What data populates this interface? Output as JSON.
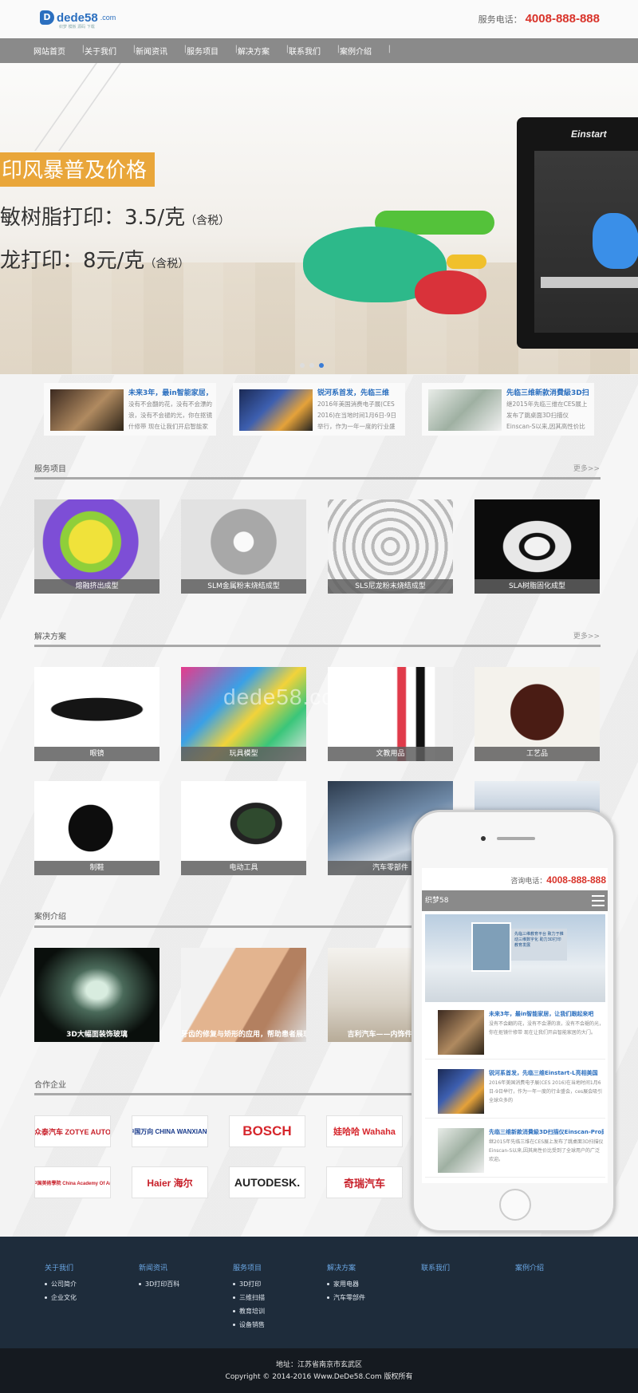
{
  "header": {
    "logo_text": "dede58",
    "logo_domain": ".com",
    "logo_sub": "织梦 模板 源码 下载",
    "hotline_label": "服务电话：",
    "hotline_number": "4008-888-888"
  },
  "nav": {
    "items": [
      {
        "label": "网站首页"
      },
      {
        "label": "关于我们"
      },
      {
        "label": "新闻资讯"
      },
      {
        "label": "服务项目"
      },
      {
        "label": "解决方案"
      },
      {
        "label": "联系我们"
      },
      {
        "label": "案例介绍"
      }
    ]
  },
  "banner": {
    "tag": "印风暴普及价格",
    "line1": "敏树脂打印：3.5/克",
    "line1_small": "（含税）",
    "line2": "龙打印：8元/克",
    "line2_small": "（含税）",
    "printer_brand": "Einstart",
    "active_slide": 3,
    "slide_count": 3
  },
  "news": [
    {
      "title": "未来3年，最in智能家居，",
      "summary": "没有不会翻的花，没有不会漂的浪，没有不会褪的光，你在抠镜什修带 现在让我们开启智能家"
    },
    {
      "title": "锐河系首发，先临三维",
      "summary": "2016年美国消费电子展(CES 2016)在当地时间1月6日-9日举行，作为一年一度的行业盛会，"
    },
    {
      "title": "先临三维新款消費級3D扫",
      "summary": "继2015年先临三维在CES展上发布了跳桌面3D扫描仪Einscan-S以来,因其高性价比的"
    }
  ],
  "services": {
    "title": "服务项目",
    "more": "更多>>",
    "items": [
      {
        "caption": "熔融挤出成型"
      },
      {
        "caption": "SLM金属粉末烧结成型"
      },
      {
        "caption": "SLS尼龙粉末烧结成型"
      },
      {
        "caption": "SLA树脂固化成型"
      }
    ]
  },
  "solutions": {
    "title": "解决方案",
    "more": "更多>>",
    "watermark": "dede58.com",
    "items": [
      {
        "caption": "眼镜"
      },
      {
        "caption": "玩具模型"
      },
      {
        "caption": "文教用品"
      },
      {
        "caption": "工艺品"
      },
      {
        "caption": "制鞋"
      },
      {
        "caption": "电动工具"
      },
      {
        "caption": "汽车零部件"
      },
      {
        "caption": ""
      }
    ]
  },
  "cases": {
    "title": "案例介绍",
    "items": [
      {
        "caption": "3D大幅面装饰玻璃"
      },
      {
        "caption": "牙齿的修复与矫形的应用，帮助患者展现"
      },
      {
        "caption": "吉利汽车——内饰件快速成"
      }
    ]
  },
  "partners": {
    "title": "合作企业",
    "items": [
      {
        "name": "众泰汽车 ZOTYE AUTO",
        "color": "#c8202a"
      },
      {
        "name": "中国万向 CHINA WANXIANG",
        "color": "#1a3c8c"
      },
      {
        "name": "BOSCH",
        "color": "#d6262c"
      },
      {
        "name": "娃哈哈 Wahaha",
        "color": "#d6262c"
      },
      {
        "name": "中国美術學院 China Academy Of Art",
        "color": "#c8202a"
      },
      {
        "name": "Haier 海尔",
        "color": "#c8202a"
      },
      {
        "name": "AUTODESK.",
        "color": "#222222"
      },
      {
        "name": "奇瑞汽车",
        "color": "#c8202a"
      }
    ]
  },
  "phone": {
    "hotline_label": "咨询电话：",
    "hotline_number": "4008-888-888",
    "site_name": "织梦58",
    "banner_text": "先临三维教育平台 致力于推动三维数字化 助力3D打印教育发展",
    "news": [
      {
        "title": "未来3年，最in智能家居，让我们跟起来吧",
        "summary": "没有不会翻的花，没有不会漂的浪，没有不会褪的光，你在抠镜什修带 现在让我们开启智能家居的大门。"
      },
      {
        "title": "锐河系首发，先临三维Einstart-L亮相美国",
        "summary": "2016年美国消费电子展(CES 2016)在当地时间1月6日-9日举行，作为一年一度的行业盛会，ces展会吸引全球众多的"
      },
      {
        "title": "先临三维新款消費級3D扫描仪Einscan-Pro即将",
        "summary": "继2015年先临三维在CES展上发布了跳桌面3D扫描仪Einscan-S以来,因其高性价比受到了全球用户的广泛欢迎。"
      }
    ]
  },
  "footer": {
    "columns": [
      {
        "heading": "关于我们",
        "links": [
          "公司简介",
          "企业文化"
        ]
      },
      {
        "heading": "新闻资讯",
        "links": [
          "3D打印百科"
        ]
      },
      {
        "heading": "服务项目",
        "links": [
          "3D打印",
          "三维扫描",
          "教育培训",
          "设备销售"
        ]
      },
      {
        "heading": "解决方案",
        "links": [
          "家用电器",
          "汽车零部件"
        ]
      },
      {
        "heading": "联系我们",
        "links": []
      },
      {
        "heading": "案例介绍",
        "links": []
      }
    ],
    "address": "地址：江苏省南京市玄武区",
    "copyright": "Copyright © 2014-2016 Www.DeDe58.Com 版权所有"
  }
}
